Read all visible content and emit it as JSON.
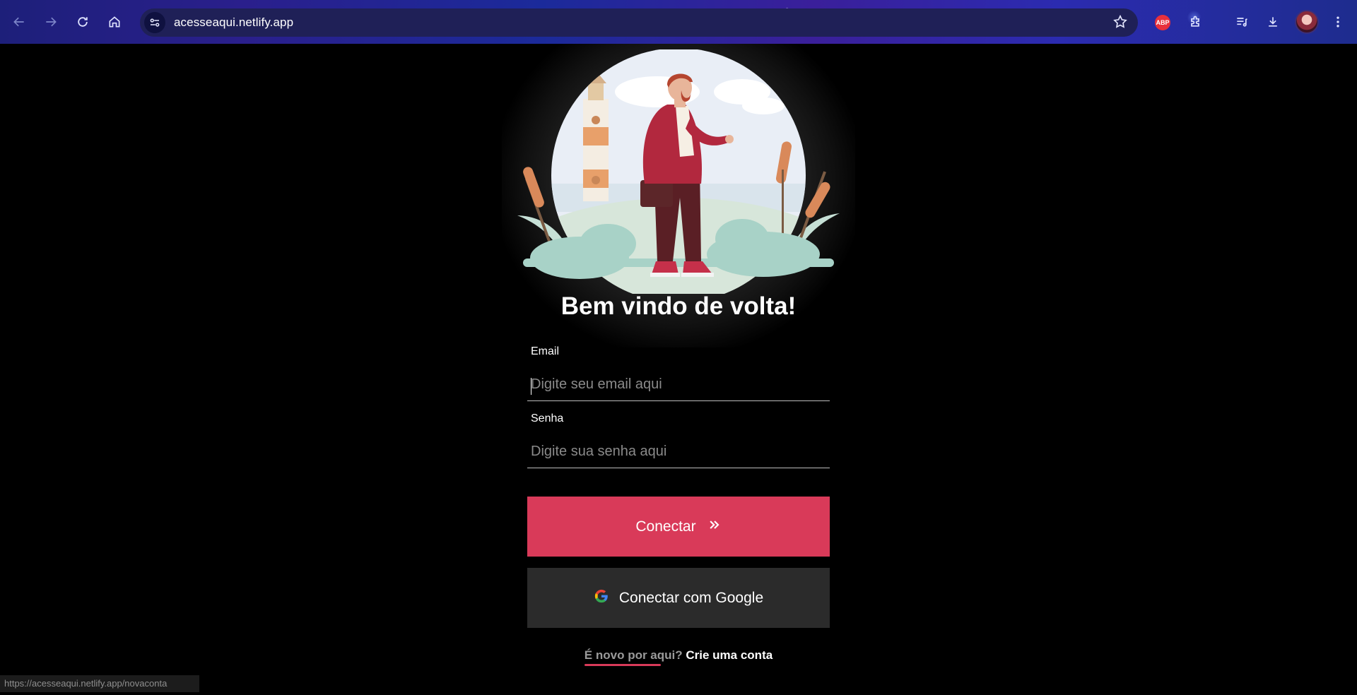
{
  "browser": {
    "url": "acesseaqui.netlify.app",
    "extension_abp_label": "ABP",
    "icons": [
      "back-icon",
      "forward-icon",
      "reload-icon",
      "home-icon",
      "site-info-icon",
      "bookmark-star-icon",
      "adblock-icon",
      "extensions-icon",
      "media-control-icon",
      "downloads-icon",
      "profile-avatar",
      "menu-icon"
    ]
  },
  "login": {
    "title": "Bem vindo de volta!",
    "email_label": "Email",
    "email_placeholder": "Digite seu email aqui",
    "password_label": "Senha",
    "password_placeholder": "Digite sua senha aqui",
    "connect_label": "Conectar",
    "google_label": "Conectar com Google",
    "signup_question": "É novo por aqui?",
    "signup_link": "Crie uma conta"
  },
  "status_bar": {
    "hover_url": "https://acesseaqui.netlify.app/novaconta"
  },
  "colors": {
    "accent": "#d93a59",
    "google_button": "#2b2b2b",
    "background": "#000000"
  }
}
